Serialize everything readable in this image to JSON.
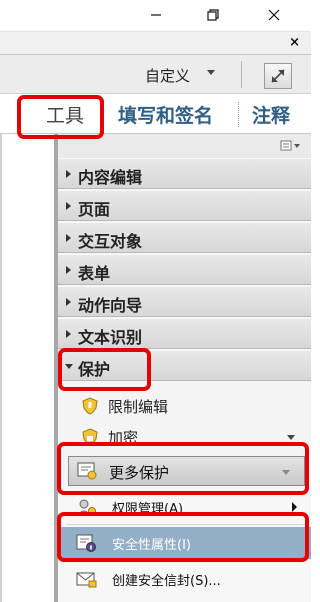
{
  "window": {
    "minimize_icon": "minimize-icon",
    "restore_icon": "restore-icon",
    "close_icon": "close-icon"
  },
  "doc_close": "×",
  "toolbar": {
    "customize_label": "自定义",
    "expand_icon": "expand-arrows-icon"
  },
  "tabs": [
    {
      "label": "工具"
    },
    {
      "label": "填写和签名"
    },
    {
      "label": "注释"
    }
  ],
  "panel": {
    "options_icon": "panel-options-icon",
    "sections": [
      {
        "label": "内容编辑",
        "expanded": false
      },
      {
        "label": "页面",
        "expanded": false
      },
      {
        "label": "交互对象",
        "expanded": false
      },
      {
        "label": "表单",
        "expanded": false
      },
      {
        "label": "动作向导",
        "expanded": false
      },
      {
        "label": "文本识别",
        "expanded": false
      },
      {
        "label": "保护",
        "expanded": true
      }
    ],
    "protect_items": [
      {
        "label": "限制编辑",
        "icon": "shield-icon"
      },
      {
        "label": "加密",
        "icon": "shield-lock-icon"
      }
    ],
    "more_protection": {
      "label": "更多保护",
      "icon": "certificate-icon"
    },
    "menu": [
      {
        "label": "权限管理(A)",
        "icon": "rights-management-icon",
        "has_submenu": true,
        "highlighted": false
      },
      {
        "label": "安全性属性(I)",
        "icon": "security-properties-icon",
        "has_submenu": false,
        "highlighted": true
      },
      {
        "label": "创建安全信封(S)...",
        "icon": "secure-envelope-icon",
        "has_submenu": false,
        "highlighted": false
      }
    ]
  },
  "colors": {
    "annotation": "#e60000",
    "tab_text": "#2f5e86",
    "menu_highlight": "#93aec7"
  }
}
